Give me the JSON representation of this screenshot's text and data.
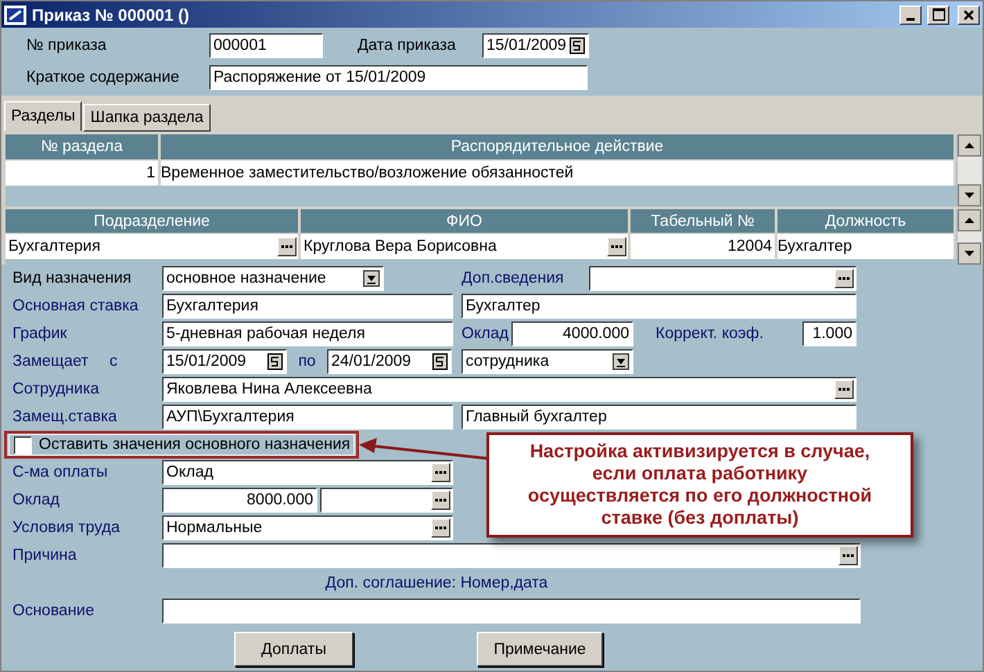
{
  "window": {
    "title": "Приказ № 000001 ()"
  },
  "header": {
    "order_no": {
      "label": "№ приказа",
      "value": "000001"
    },
    "order_date": {
      "label": "Дата приказа",
      "value": "15/01/2009"
    },
    "summary": {
      "label": "Краткое содержание",
      "value": "Распоряжение от 15/01/2009"
    }
  },
  "tabs": [
    {
      "label": "Разделы",
      "selected": true
    },
    {
      "label": "Шапка раздела",
      "selected": false
    }
  ],
  "sections_table": {
    "columns": [
      "№ раздела",
      "Распорядительное действие"
    ],
    "rows": [
      {
        "number": "1",
        "action": "Временное заместительство/возложение обязанностей"
      }
    ]
  },
  "staff_table": {
    "columns": [
      "Подразделение",
      "ФИО",
      "Табельный №",
      "Должность"
    ],
    "rows": [
      {
        "department": "Бухгалтерия",
        "name": "Круглова Вера Борисовна",
        "tab_no": "12004",
        "position": "Бухгалтер"
      }
    ]
  },
  "form": {
    "appointment_type": {
      "label": "Вид назначения",
      "value": "основное назначение"
    },
    "extra_info": {
      "label": "Доп.сведения"
    },
    "base_rate": {
      "label": "Основная ставка",
      "value": "Бухгалтерия",
      "value_2": "Бухгалтер"
    },
    "schedule": {
      "label": "График",
      "value": "5-дневная рабочая неделя"
    },
    "salary": {
      "label": "Оклад",
      "value": "4000.000"
    },
    "coefficient": {
      "label": "Коррект. коэф.",
      "value": "1.000"
    },
    "replaces": {
      "label": "Замещает",
      "from_label": "с",
      "from": "15/01/2009",
      "to_label": "по",
      "to": "24/01/2009",
      "whom": "сотрудника"
    },
    "employee": {
      "label": "Сотрудника",
      "value": "Яковлева Нина Алексеевна"
    },
    "replacement_rate": {
      "label": "Замещ.ставка",
      "value": "АУП\\Бухгалтерия",
      "value_2": "Главный бухгалтер"
    },
    "keep_main": {
      "label": "Оставить значения основного назначения",
      "checked": false
    },
    "pay_system": {
      "label": "С-ма оплаты",
      "value": "Оклад"
    },
    "salary_2": {
      "label": "Оклад",
      "value": "8000.000"
    },
    "conditions": {
      "label": "Условия труда",
      "value": "Нормальные"
    },
    "reason": {
      "label": "Причина"
    },
    "agreement_note": "Доп. соглашение: Номер,дата",
    "basis": {
      "label": "Основание"
    }
  },
  "buttons": [
    "Доплаты",
    "Примечание"
  ],
  "callout": {
    "lines": [
      "Настройка активизируется в случае,",
      "если оплата работнику",
      "осуществляется по его должностной",
      "ставке (без доплаты)"
    ]
  }
}
